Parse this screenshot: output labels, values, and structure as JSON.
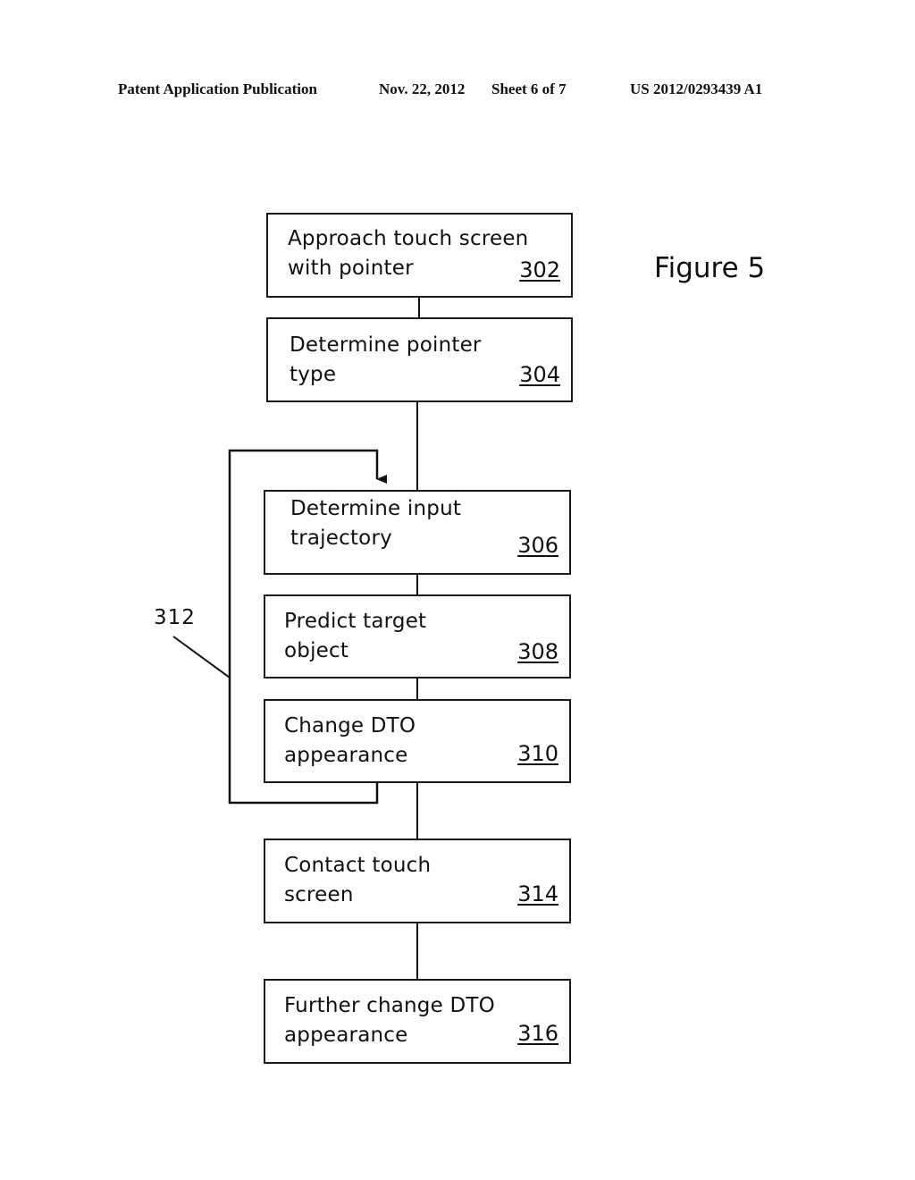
{
  "header": {
    "publication": "Patent Application Publication",
    "date": "Nov. 22, 2012",
    "sheet": "Sheet 6 of 7",
    "number": "US 2012/0293439 A1"
  },
  "figure_label": "Figure 5",
  "loop_label": "312",
  "steps": [
    {
      "line1": "Approach touch screen",
      "line2": "with pointer",
      "ref": "302"
    },
    {
      "line1": "Determine pointer",
      "line2": "type",
      "ref": "304"
    },
    {
      "line1": "Determine input",
      "line2": "trajectory",
      "ref": "306"
    },
    {
      "line1": "Predict target",
      "line2": "object",
      "ref": "308"
    },
    {
      "line1": "Change DTO",
      "line2": "appearance",
      "ref": "310"
    },
    {
      "line1": "Contact touch",
      "line2": "screen",
      "ref": "314"
    },
    {
      "line1": "Further change DTO",
      "line2": "appearance",
      "ref": "316"
    }
  ]
}
